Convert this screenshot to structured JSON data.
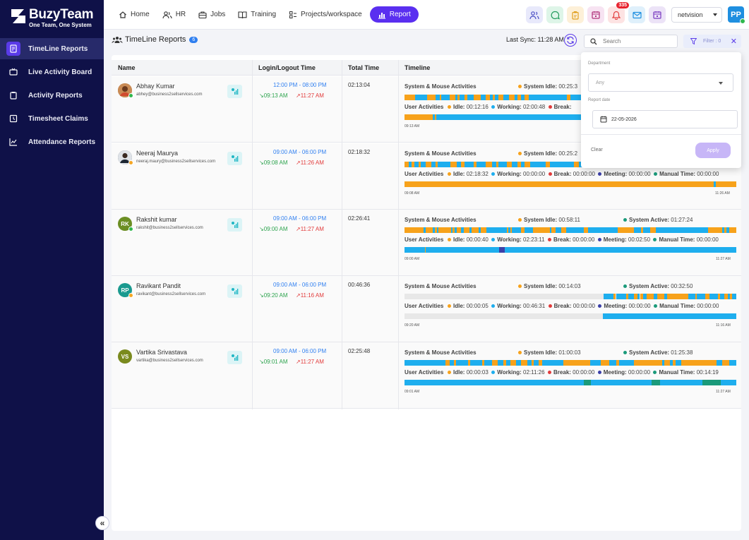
{
  "brand": {
    "name": "BuzyTeam",
    "tagline": "One Team, One System"
  },
  "sidebar": {
    "items": [
      {
        "label": "TimeLine Reports",
        "active": true
      },
      {
        "label": "Live Activity Board"
      },
      {
        "label": "Activity Reports"
      },
      {
        "label": "Timesheet Claims"
      },
      {
        "label": "Attendance Reports"
      }
    ]
  },
  "topnav": {
    "items": [
      {
        "label": "Home",
        "icon": "home-icon"
      },
      {
        "label": "HR",
        "icon": "people-icon"
      },
      {
        "label": "Jobs",
        "icon": "briefcase-icon"
      },
      {
        "label": "Training",
        "icon": "book-icon"
      },
      {
        "label": "Projects/workspace",
        "icon": "workspace-icon"
      },
      {
        "label": "Report",
        "icon": "report-icon",
        "active": true
      }
    ],
    "notification_count": "335",
    "org_select": "netvision",
    "user_initials": "PP"
  },
  "subheader": {
    "title": "TimeLine Reports",
    "count": "6",
    "last_sync": "Last Sync: 11:28 AM",
    "search_placeholder": "Search",
    "filter_label": "Filter : 0"
  },
  "table": {
    "headers": [
      "Name",
      "Login/Logout Time",
      "Total Time",
      "Timeline"
    ],
    "labels": {
      "system": "System & Mouse Activities",
      "user": "User Activities",
      "system_idle": "System Idle:",
      "system_active": "System Active:",
      "idle": "Idle:",
      "working": "Working:",
      "break": "Break:",
      "meeting": "Meeting:",
      "manual": "Manual Time:"
    },
    "rows": [
      {
        "name": "Abhay Kumar",
        "email": "abhey@business2sellservices.com",
        "initials": "",
        "avatar_color": "#b0703a",
        "status_color": "#2fb84d",
        "shift": "12:00 PM - 08:00 PM",
        "login": "09:13 AM",
        "logout": "11:27 AM",
        "total": "02:13:04",
        "system_idle": "00:25:3",
        "system_active": "",
        "idle": "00:12:16",
        "working": "02:00:48",
        "break": "",
        "meeting": "",
        "manual": "",
        "start": "09:13 AM",
        "end": ""
      },
      {
        "name": "Neeraj Maurya",
        "email": "neeraj.maury@business2sellservices.com",
        "initials": "",
        "avatar_color": "#2c3a4a",
        "status_color": "#f5a623",
        "shift": "09:00 AM - 06:00 PM",
        "login": "09:08 AM",
        "logout": "11:26 AM",
        "total": "02:18:32",
        "system_idle": "00:25:2",
        "system_active": "",
        "idle": "02:18:32",
        "working": "00:00:00",
        "break": "00:00:00",
        "meeting": "00:00:00",
        "manual": "00:00:00",
        "start": "09:08 AM",
        "end": "11:26 AM"
      },
      {
        "name": "Rakshit kumar",
        "email": "rakshit@business2sellservices.com",
        "initials": "RK",
        "avatar_color": "#6b8e23",
        "status_color": "#2fb84d",
        "shift": "09:00 AM - 06:00 PM",
        "login": "09:00 AM",
        "logout": "11:27 AM",
        "total": "02:26:41",
        "system_idle": "00:58:11",
        "system_active": "01:27:24",
        "idle": "00:00:40",
        "working": "02:23:11",
        "break": "00:00:00",
        "meeting": "00:02:50",
        "manual": "00:00:00",
        "start": "09:00 AM",
        "end": "11:27 AM"
      },
      {
        "name": "Ravikant Pandit",
        "email": "ravikant@business2sellservices.com",
        "initials": "RP",
        "avatar_color": "#1a9a8f",
        "status_color": "#f5a623",
        "shift": "09:00 AM - 06:00 PM",
        "login": "09:20 AM",
        "logout": "11:16 AM",
        "total": "00:46:36",
        "system_idle": "00:14:03",
        "system_active": "00:32:50",
        "idle": "00:00:05",
        "working": "00:46:31",
        "break": "00:00:00",
        "meeting": "00:00:00",
        "manual": "00:00:00",
        "start": "09:20 AM",
        "end": "11:16 AM"
      },
      {
        "name": "Vartika Srivastava",
        "email": "vartika@business2sellservices.com",
        "initials": "VS",
        "avatar_color": "#7a8a1e",
        "status_color": "",
        "shift": "09:00 AM - 06:00 PM",
        "login": "09:01 AM",
        "logout": "11:27 AM",
        "total": "02:25:48",
        "system_idle": "01:00:03",
        "system_active": "01:25:38",
        "idle": "00:00:03",
        "working": "02:11:26",
        "break": "00:00:00",
        "meeting": "00:00:00",
        "manual": "00:14:19",
        "start": "09:01 AM",
        "end": "11:27 AM"
      }
    ]
  },
  "filter_panel": {
    "department_label": "Department",
    "department_value": "Any",
    "date_label": "Report date",
    "date_value": "22-05-2026",
    "clear": "Clear",
    "apply": "Apply"
  },
  "colors": {
    "sidebar_bg": "#0f1148",
    "accent": "#5a2ff0",
    "working": "#1eaeee",
    "idle": "#f7a21b",
    "break": "#e23b3b",
    "meeting": "#3b3fa8",
    "manual": "#1a9a7a"
  }
}
